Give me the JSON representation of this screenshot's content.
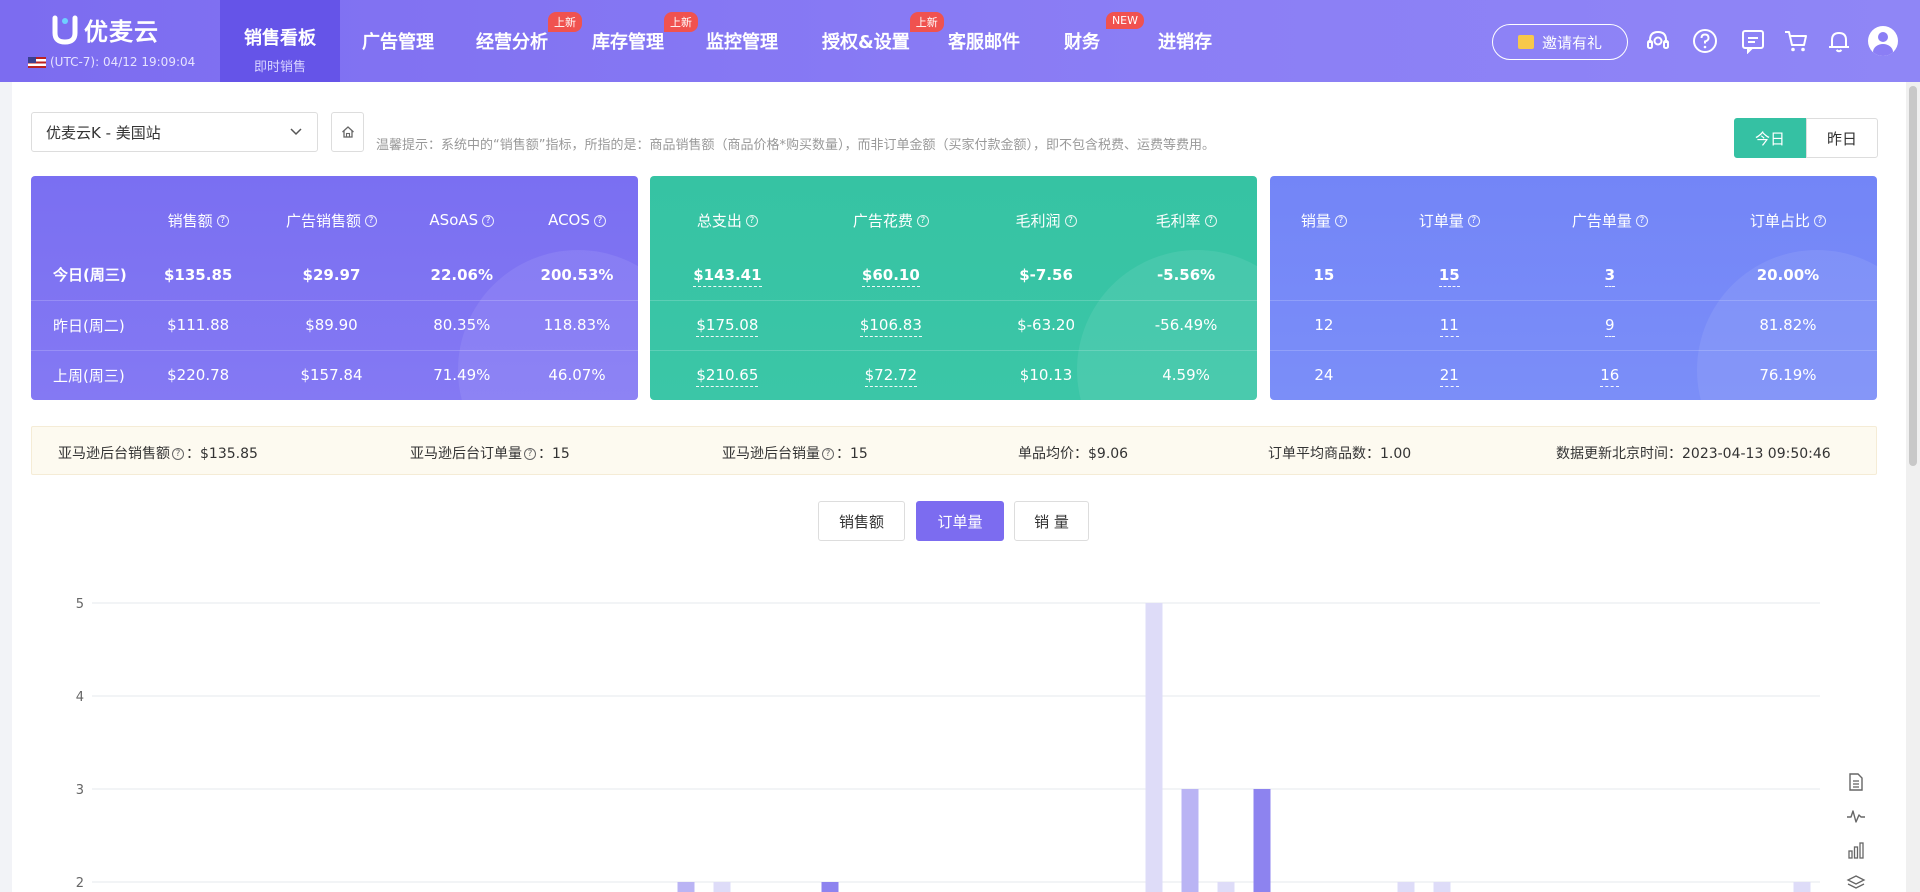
{
  "app": {
    "name": "优麦云",
    "clock": "(UTC-7): 04/12 19:09:04",
    "invite_label": "邀请有礼",
    "brand_color": "#7c6cf0"
  },
  "nav": {
    "active": {
      "label": "销售看板",
      "sub": "即时销售"
    },
    "items": [
      {
        "label": "广告管理",
        "badge": ""
      },
      {
        "label": "经营分析",
        "badge": "上新"
      },
      {
        "label": "库存管理",
        "badge": "上新"
      },
      {
        "label": "监控管理",
        "badge": ""
      },
      {
        "label": "授权&设置",
        "badge": "上新"
      },
      {
        "label": "客服邮件",
        "badge": ""
      },
      {
        "label": "财务",
        "badge": "NEW"
      },
      {
        "label": "进销存",
        "badge": ""
      }
    ],
    "icons": [
      "headset-icon",
      "help-icon",
      "message-icon",
      "cart-icon",
      "bell-icon",
      "avatar-icon"
    ]
  },
  "toolbar": {
    "store": "优麦云K - 美国站",
    "tip": "温馨提示：系统中的“销售额”指标，所指的是：商品销售额（商品价格*购买数量），而非订单金额（买家付款金额），即不包含税费、运费等费用。",
    "today": "今日",
    "yesterday": "昨日"
  },
  "cards": {
    "sales": {
      "headers": [
        "销售额",
        "广告销售额",
        "ASoAS",
        "ACOS"
      ],
      "rows": [
        {
          "label": "今日(周三)",
          "values": [
            "$135.85",
            "$29.97",
            "22.06%",
            "200.53%"
          ]
        },
        {
          "label": "昨日(周二)",
          "values": [
            "$111.88",
            "$89.90",
            "80.35%",
            "118.83%"
          ]
        },
        {
          "label": "上周(周三)",
          "values": [
            "$220.78",
            "$157.84",
            "71.49%",
            "46.07%"
          ]
        }
      ]
    },
    "cost": {
      "headers": [
        "总支出",
        "广告花费",
        "毛利润",
        "毛利率"
      ],
      "rows": [
        {
          "values": [
            "$143.41",
            "$60.10",
            "$-7.56",
            "-5.56%"
          ]
        },
        {
          "values": [
            "$175.08",
            "$106.83",
            "$-63.20",
            "-56.49%"
          ]
        },
        {
          "values": [
            "$210.65",
            "$72.72",
            "$10.13",
            "4.59%"
          ]
        }
      ]
    },
    "volume": {
      "headers": [
        "销量",
        "订单量",
        "广告单量",
        "订单占比"
      ],
      "rows": [
        {
          "values": [
            "15",
            "15",
            "3",
            "20.00%"
          ]
        },
        {
          "values": [
            "12",
            "11",
            "9",
            "81.82%"
          ]
        },
        {
          "values": [
            "24",
            "21",
            "16",
            "76.19%"
          ]
        }
      ]
    }
  },
  "infobar": {
    "sales_label": "亚马逊后台销售额",
    "sales_value": "：$135.85",
    "orders_label": "亚马逊后台订单量",
    "orders_value": "：15",
    "units_label": "亚马逊后台销量",
    "units_value": "：15",
    "avg_price": "单品均价：$9.06",
    "avg_items": "订单平均商品数：1.00",
    "updated": "数据更新北京时间：2023-04-13 09:50:46"
  },
  "metrics": {
    "sales": "销售额",
    "orders": "订单量",
    "units": "销 量"
  },
  "chart_data": {
    "type": "bar",
    "y_ticks": [
      "5",
      "4",
      "3",
      "2"
    ],
    "ylim": [
      1.8,
      5
    ],
    "grid": true,
    "x_slot_count": 48,
    "series": [
      {
        "color": "#8d83ef",
        "points": [
          [
            20,
            2
          ],
          [
            32,
            3
          ]
        ]
      },
      {
        "color": "#bab4f4",
        "points": [
          [
            16,
            2
          ],
          [
            30,
            3
          ]
        ]
      },
      {
        "color": "#dedcf8",
        "points": [
          [
            17,
            2
          ],
          [
            29,
            5
          ],
          [
            31,
            2
          ],
          [
            36,
            2
          ],
          [
            37,
            2
          ],
          [
            47,
            2
          ]
        ]
      }
    ]
  }
}
